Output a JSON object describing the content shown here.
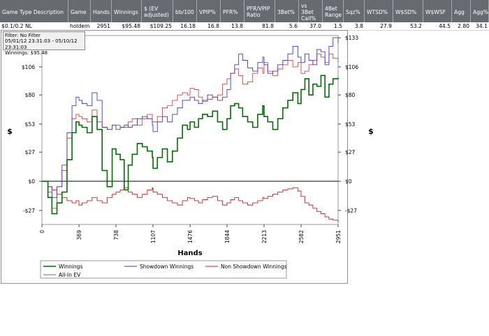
{
  "stats_table": {
    "columns": [
      {
        "label": "Game Type Description",
        "w": 98
      },
      {
        "label": "Game",
        "w": 32
      },
      {
        "label": "Hands",
        "w": 30
      },
      {
        "label": "Winnings",
        "w": 43
      },
      {
        "label": "$ (EV adjusted)",
        "w": 45
      },
      {
        "label": "bb/100",
        "w": 34
      },
      {
        "label": "VPIP%",
        "w": 34
      },
      {
        "label": "PFR%",
        "w": 34
      },
      {
        "label": "PFR/VPIP Ratio",
        "w": 44
      },
      {
        "label": "3Bet%",
        "w": 34
      },
      {
        "label": "vs 3Bet Call%",
        "w": 34
      },
      {
        "label": "4Bet Range",
        "w": 30
      },
      {
        "label": "Sqz%",
        "w": 30
      },
      {
        "label": "WTSD%",
        "w": 41
      },
      {
        "label": "W$SD%",
        "w": 43
      },
      {
        "label": "W$WSF",
        "w": 41
      },
      {
        "label": "Agg",
        "w": 27
      },
      {
        "label": "Agg%",
        "w": 26
      }
    ],
    "row": [
      "$0.1/0.2 NL",
      "holdem",
      "2951",
      "$95.48",
      "$109.25",
      "16.18",
      "16.8",
      "13.8",
      "81.8",
      "5.6",
      "37.0",
      "1.5",
      "3.8",
      "27.9",
      "53.2",
      "44.5",
      "2.80",
      "34.1"
    ]
  },
  "info_box": {
    "line1": "Filter: No Filter",
    "line2": "05/01/12 23:31:03 - 05/10/12 23:31:03",
    "line3": "Winnings: $95.48"
  },
  "chart_data": {
    "type": "line",
    "xlabel": "Hands",
    "ylabel": "$",
    "ylim": [
      -40,
      135
    ],
    "xlim": [
      0,
      2951
    ],
    "x_ticks": [
      "0",
      "369",
      "738",
      "1107",
      "1476",
      "1844",
      "2213",
      "2582",
      "2951"
    ],
    "y_ticks_left": [
      "$106",
      "$80",
      "$53",
      "$27",
      "$0",
      "-$27"
    ],
    "y_ticks_right": [
      "$133",
      "$106",
      "$80",
      "$53",
      "$27",
      "$0",
      "-$27"
    ],
    "y_tick_values_left": [
      106,
      80,
      53,
      27,
      0,
      -27
    ],
    "y_tick_values_right": [
      133,
      106,
      80,
      53,
      27,
      0,
      -27
    ],
    "legend_placement": "bottom-left",
    "series": [
      {
        "name": "Winnings",
        "color": "#007000",
        "x": [
          0,
          60,
          100,
          150,
          200,
          250,
          300,
          340,
          369,
          400,
          450,
          500,
          550,
          600,
          650,
          700,
          738,
          780,
          820,
          860,
          900,
          950,
          1000,
          1050,
          1100,
          1107,
          1150,
          1200,
          1250,
          1300,
          1350,
          1400,
          1450,
          1476,
          1520,
          1560,
          1600,
          1650,
          1700,
          1750,
          1800,
          1844,
          1880,
          1920,
          1960,
          2000,
          2050,
          2100,
          2150,
          2200,
          2213,
          2250,
          2300,
          2350,
          2400,
          2450,
          2500,
          2550,
          2582,
          2620,
          2660,
          2700,
          2740,
          2780,
          2820,
          2860,
          2900,
          2951
        ],
        "y": [
          0,
          -15,
          -30,
          -20,
          -10,
          20,
          45,
          55,
          52,
          50,
          45,
          60,
          48,
          10,
          -5,
          30,
          25,
          20,
          -8,
          15,
          25,
          35,
          32,
          28,
          22,
          12,
          22,
          30,
          18,
          28,
          40,
          52,
          48,
          55,
          50,
          58,
          62,
          60,
          65,
          55,
          48,
          58,
          70,
          72,
          68,
          60,
          55,
          50,
          62,
          70,
          60,
          55,
          48,
          58,
          68,
          75,
          82,
          72,
          85,
          95,
          80,
          90,
          88,
          98,
          78,
          90,
          95,
          96
        ]
      },
      {
        "name": "Showdown Winnings",
        "color": "#3a3ad4",
        "x": [
          0,
          60,
          100,
          150,
          200,
          250,
          300,
          340,
          369,
          400,
          450,
          500,
          550,
          600,
          650,
          700,
          738,
          780,
          820,
          860,
          900,
          950,
          1000,
          1050,
          1100,
          1107,
          1150,
          1200,
          1250,
          1300,
          1350,
          1400,
          1450,
          1476,
          1520,
          1560,
          1600,
          1650,
          1700,
          1750,
          1800,
          1844,
          1880,
          1920,
          1960,
          2000,
          2050,
          2100,
          2150,
          2200,
          2213,
          2250,
          2300,
          2350,
          2400,
          2450,
          2500,
          2550,
          2582,
          2620,
          2660,
          2700,
          2740,
          2780,
          2820,
          2860,
          2900,
          2951
        ],
        "y": [
          0,
          -5,
          -15,
          -5,
          15,
          45,
          70,
          78,
          75,
          72,
          70,
          82,
          75,
          50,
          48,
          52,
          48,
          50,
          52,
          50,
          52,
          58,
          60,
          58,
          52,
          46,
          55,
          60,
          55,
          62,
          68,
          75,
          75,
          78,
          75,
          72,
          75,
          80,
          78,
          75,
          78,
          85,
          100,
          108,
          118,
          112,
          105,
          102,
          110,
          115,
          108,
          100,
          102,
          108,
          112,
          118,
          125,
          115,
          110,
          118,
          112,
          108,
          122,
          120,
          108,
          125,
          133,
          128
        ]
      },
      {
        "name": "Non Showdown Winnings",
        "color": "#cc2020",
        "x": [
          0,
          60,
          100,
          150,
          200,
          250,
          300,
          340,
          369,
          400,
          450,
          500,
          550,
          600,
          650,
          700,
          738,
          780,
          820,
          860,
          900,
          950,
          1000,
          1050,
          1100,
          1107,
          1150,
          1200,
          1250,
          1300,
          1350,
          1400,
          1450,
          1476,
          1520,
          1560,
          1600,
          1650,
          1700,
          1750,
          1800,
          1844,
          1880,
          1920,
          1960,
          2000,
          2050,
          2100,
          2150,
          2200,
          2213,
          2250,
          2300,
          2350,
          2400,
          2450,
          2500,
          2550,
          2582,
          2620,
          2660,
          2700,
          2740,
          2780,
          2820,
          2860,
          2900,
          2951
        ],
        "y": [
          0,
          -5,
          -8,
          -12,
          -15,
          -18,
          -20,
          -18,
          -22,
          -20,
          -18,
          -15,
          -18,
          -20,
          -15,
          -12,
          -10,
          -8,
          -6,
          -10,
          -12,
          -15,
          -12,
          -8,
          -6,
          -10,
          -12,
          -15,
          -18,
          -20,
          -22,
          -18,
          -15,
          -16,
          -18,
          -20,
          -17,
          -15,
          -14,
          -18,
          -22,
          -20,
          -17,
          -15,
          -18,
          -20,
          -22,
          -20,
          -18,
          -15,
          -16,
          -14,
          -12,
          -10,
          -8,
          -7,
          -6,
          -9,
          -14,
          -20,
          -22,
          -25,
          -28,
          -30,
          -33,
          -35,
          -36,
          -38
        ]
      },
      {
        "name": "All-In EV",
        "color": "#e04040",
        "x": [
          0,
          60,
          100,
          150,
          200,
          250,
          300,
          340,
          369,
          400,
          450,
          500,
          550,
          600,
          650,
          700,
          738,
          780,
          820,
          860,
          900,
          950,
          1000,
          1050,
          1100,
          1107,
          1150,
          1200,
          1250,
          1300,
          1350,
          1400,
          1450,
          1476,
          1520,
          1560,
          1600,
          1650,
          1700,
          1750,
          1800,
          1844,
          1880,
          1920,
          1960,
          2000,
          2050,
          2100,
          2150,
          2200,
          2213,
          2250,
          2300,
          2350,
          2400,
          2450,
          2500,
          2550,
          2582,
          2620,
          2660,
          2700,
          2740,
          2780,
          2820,
          2860,
          2900,
          2951
        ],
        "y": [
          0,
          -10,
          -25,
          -5,
          10,
          40,
          58,
          62,
          60,
          58,
          55,
          66,
          55,
          50,
          48,
          52,
          52,
          50,
          50,
          55,
          58,
          52,
          58,
          62,
          55,
          55,
          60,
          68,
          70,
          75,
          80,
          82,
          80,
          86,
          85,
          78,
          74,
          76,
          78,
          80,
          90,
          95,
          100,
          104,
          98,
          90,
          92,
          100,
          105,
          100,
          110,
          102,
          98,
          104,
          108,
          112,
          106,
          110,
          100,
          102,
          108,
          112,
          118,
          115,
          110,
          118,
          114,
          110
        ]
      }
    ]
  },
  "colors": {
    "header_bg": "#676b71",
    "zero_line": "#000000"
  }
}
